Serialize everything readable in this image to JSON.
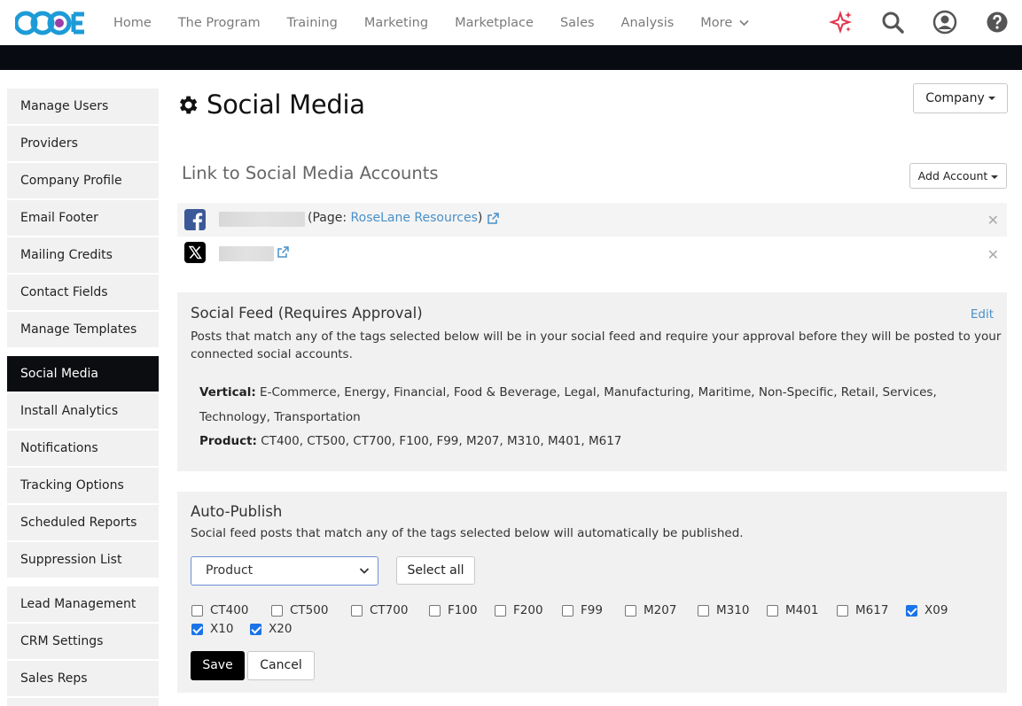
{
  "app": {
    "logo_text": "CCOE",
    "brand_colors": {
      "primary": "#1d9bd7",
      "accent": "#9b3fa8",
      "black_bar": "#080b12",
      "link": "#4a90c8",
      "checkbox": "#1a73e8"
    }
  },
  "topnav": {
    "items": [
      {
        "label": "Home"
      },
      {
        "label": "The Program"
      },
      {
        "label": "Training"
      },
      {
        "label": "Marketing"
      },
      {
        "label": "Marketplace"
      },
      {
        "label": "Sales"
      },
      {
        "label": "Analysis"
      },
      {
        "label": "More"
      }
    ],
    "icons": [
      "sparkle-icon",
      "search-icon",
      "user-icon",
      "help-icon"
    ]
  },
  "sidebar": {
    "items": [
      {
        "label": "Manage Users"
      },
      {
        "label": "Providers"
      },
      {
        "label": "Company Profile"
      },
      {
        "label": "Email Footer"
      },
      {
        "label": "Mailing Credits"
      },
      {
        "label": "Contact Fields"
      },
      {
        "label": "Manage Templates"
      },
      {
        "label": "Social Media",
        "active": true
      },
      {
        "label": "Install Analytics"
      },
      {
        "label": "Notifications"
      },
      {
        "label": "Tracking Options"
      },
      {
        "label": "Scheduled Reports"
      },
      {
        "label": "Suppression List"
      },
      {
        "label": "Lead Management"
      },
      {
        "label": "CRM Settings"
      },
      {
        "label": "Sales Reps"
      }
    ]
  },
  "main": {
    "title": "Social Media",
    "title_icon": "gear-icon",
    "company_button": "Company",
    "accounts_heading": "Link to Social Media Accounts",
    "add_account_button": "Add Account",
    "accounts": [
      {
        "network": "facebook",
        "icon": "facebook-icon",
        "page_prefix": "(Page: ",
        "page_name": "RoseLane Resources",
        "page_suffix": ")"
      },
      {
        "network": "x",
        "icon": "x-logo-icon"
      }
    ],
    "social_feed": {
      "title": "Social Feed (Requires Approval)",
      "edit_label": "Edit",
      "description": "Posts that match any of the tags selected below will be in your social feed and require your approval before they will be posted to your connected social accounts.",
      "vertical_label": "Vertical:",
      "vertical_values": "E-Commerce, Energy, Financial, Food & Beverage, Legal, Manufacturing, Maritime, Non-Specific, Retail, Services, Technology, Transportation",
      "product_label": "Product:",
      "product_values": "CT400, CT500, CT700, F100, F99, M207, M310, M401, M617"
    },
    "auto_publish": {
      "title": "Auto-Publish",
      "description": "Social feed posts that match any of the tags selected below will automatically be published.",
      "select_value": "Product",
      "select_all_label": "Select all",
      "checkboxes": [
        {
          "label": "CT400",
          "checked": false
        },
        {
          "label": "CT500",
          "checked": false
        },
        {
          "label": "CT700",
          "checked": false
        },
        {
          "label": "F100",
          "checked": false
        },
        {
          "label": "F200",
          "checked": false
        },
        {
          "label": "F99",
          "checked": false
        },
        {
          "label": "M207",
          "checked": false
        },
        {
          "label": "M310",
          "checked": false
        },
        {
          "label": "M401",
          "checked": false
        },
        {
          "label": "M617",
          "checked": false
        },
        {
          "label": "X09",
          "checked": true
        },
        {
          "label": "X10",
          "checked": true
        },
        {
          "label": "X20",
          "checked": true
        }
      ],
      "save_label": "Save",
      "cancel_label": "Cancel"
    }
  }
}
